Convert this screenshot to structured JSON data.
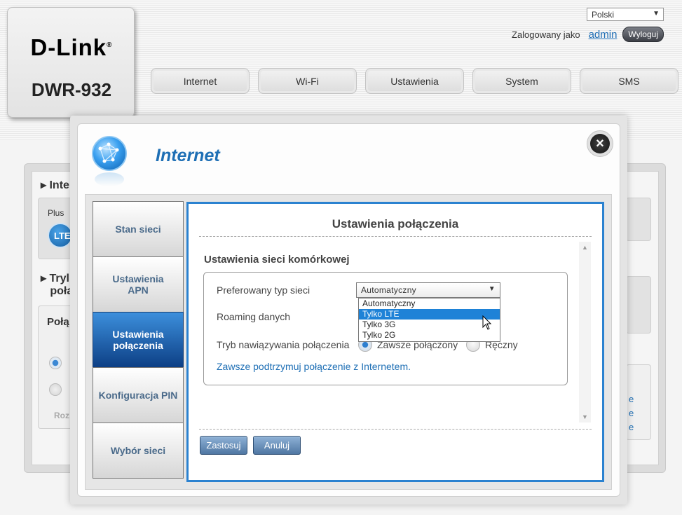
{
  "header": {
    "brand": "D-Link",
    "brand_mark": "®",
    "model": "DWR-932",
    "language": "Polski",
    "logged_in_as": "Zalogowany jako",
    "user": "admin",
    "logout": "Wyloguj"
  },
  "nav": {
    "internet": "Internet",
    "wifi": "Wi-Fi",
    "settings": "Ustawienia",
    "system": "System",
    "sms": "SMS"
  },
  "background": {
    "section1": "Inte",
    "plus": "Plus",
    "lte": "LTE",
    "section2_line1": "Tryl",
    "section2_line2": "poła",
    "pola": "Połą",
    "roz": "Roz",
    "e1": "e",
    "e2": "e",
    "e3": "e"
  },
  "modal": {
    "title": "Internet",
    "close": "×",
    "menu": {
      "status": "Stan sieci",
      "apn": "Ustawienia APN",
      "connection": "Ustawienia połączenia",
      "pin": "Konfiguracja PIN",
      "network": "Wybór sieci"
    },
    "panel_heading": "Ustawienia połączenia",
    "section_title": "Ustawienia sieci komórkowej",
    "network_type_label": "Preferowany typ sieci",
    "network_type_value": "Automatyczny",
    "network_type_options": [
      "Automatyczny",
      "Tylko LTE",
      "Tylko 3G",
      "Tylko 2G"
    ],
    "roaming_label": "Roaming danych",
    "connection_mode_label": "Tryb nawiązywania połączenia",
    "always_on": "Zawsze połączony",
    "manual": "Ręczny",
    "keepalive": "Zawsze podtrzymuj połączenie z Internetem.",
    "apply": "Zastosuj",
    "cancel": "Anuluj"
  }
}
